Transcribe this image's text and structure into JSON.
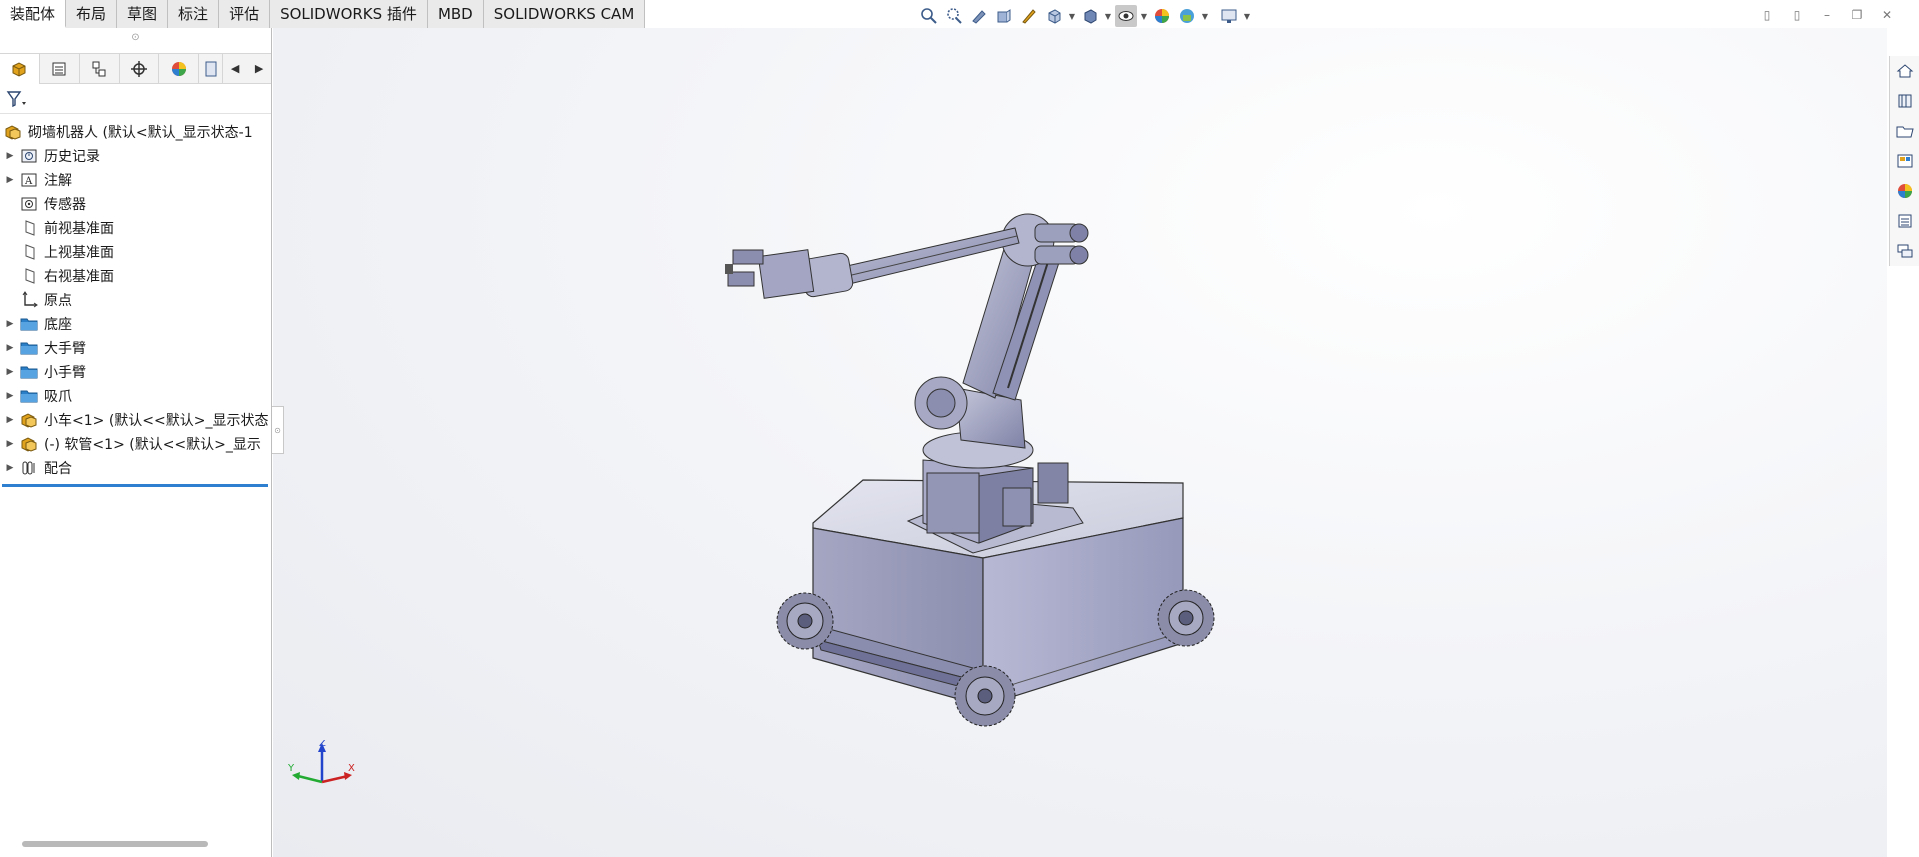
{
  "tabs": [
    {
      "label": "装配体",
      "active": true
    },
    {
      "label": "布局"
    },
    {
      "label": "草图"
    },
    {
      "label": "标注"
    },
    {
      "label": "评估"
    },
    {
      "label": "SOLIDWORKS 插件"
    },
    {
      "label": "MBD"
    },
    {
      "label": "SOLIDWORKS CAM"
    }
  ],
  "hud_icons": [
    "zoom-to-fit-icon",
    "zoom-area-icon",
    "previous-view-icon",
    "section-view-icon",
    "dynamic-annotation-icon",
    "view-orientation-icon",
    "display-style-icon",
    "hide-show-items-icon",
    "edit-appearance-icon",
    "apply-scene-icon",
    "view-settings-icon"
  ],
  "panel_tabs": [
    "featuremanager-icon",
    "propertymanager-icon",
    "configurationmanager-icon",
    "dimxpertmanager-icon",
    "displaymanager-icon",
    "cam-tree-icon"
  ],
  "tree": {
    "root": "砌墙机器人  (默认<默认_显示状态-1",
    "items": [
      {
        "label": "历史记录",
        "icon": "history-icon",
        "expandable": true
      },
      {
        "label": "注解",
        "icon": "annotations-icon",
        "expandable": true
      },
      {
        "label": "传感器",
        "icon": "sensors-icon",
        "expandable": false
      },
      {
        "label": "前视基准面",
        "icon": "plane-icon",
        "expandable": false
      },
      {
        "label": "上视基准面",
        "icon": "plane-icon",
        "expandable": false
      },
      {
        "label": "右视基准面",
        "icon": "plane-icon",
        "expandable": false
      },
      {
        "label": "原点",
        "icon": "origin-icon",
        "expandable": false
      },
      {
        "label": "底座",
        "icon": "folder-icon",
        "expandable": true
      },
      {
        "label": "大手臂",
        "icon": "folder-icon",
        "expandable": true
      },
      {
        "label": "小手臂",
        "icon": "folder-icon",
        "expandable": true
      },
      {
        "label": "吸爪",
        "icon": "folder-icon",
        "expandable": true
      },
      {
        "label": "小车<1> (默认<<默认>_显示状态",
        "icon": "subassembly-icon",
        "expandable": true
      },
      {
        "label": "(-) 软管<1> (默认<<默认>_显示",
        "icon": "subassembly-icon",
        "expandable": true
      },
      {
        "label": "配合",
        "icon": "mates-icon",
        "expandable": true
      }
    ]
  },
  "triad": {
    "x": "X",
    "y": "Y",
    "z": "Z"
  },
  "taskpane_icons": [
    "solidworks-resources-icon",
    "design-library-icon",
    "file-explorer-icon",
    "view-palette-icon",
    "appearances-scenes-icon",
    "custom-properties-icon",
    "forum-icon"
  ],
  "colors": {
    "accent": "#2f7fd0",
    "folder": "#2a7fc8",
    "part": "#e0a21c",
    "model": "#9da0b8"
  }
}
